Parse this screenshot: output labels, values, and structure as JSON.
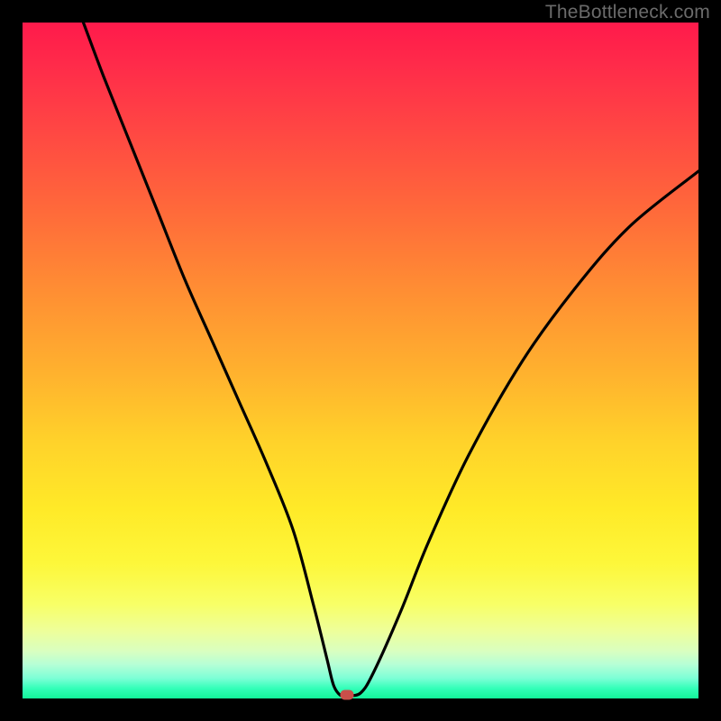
{
  "watermark": "TheBottleneck.com",
  "chart_data": {
    "type": "line",
    "title": "",
    "xlabel": "",
    "ylabel": "",
    "xlim": [
      0,
      100
    ],
    "ylim": [
      0,
      100
    ],
    "grid": false,
    "legend": false,
    "background_gradient": {
      "top": "#ff1a4b",
      "mid": "#ffe128",
      "bottom": "#13f59a"
    },
    "series": [
      {
        "name": "bottleneck-curve",
        "color": "#000000",
        "x": [
          9,
          12,
          16,
          20,
          24,
          28,
          32,
          36,
          40,
          43,
          45,
          46,
          47,
          48,
          50,
          52,
          56,
          60,
          66,
          74,
          82,
          90,
          100
        ],
        "y": [
          100,
          92,
          82,
          72,
          62,
          53,
          44,
          35,
          25,
          14,
          6,
          2,
          0.5,
          0.5,
          0.8,
          4,
          13,
          23,
          36,
          50,
          61,
          70,
          78
        ]
      }
    ],
    "marker": {
      "name": "optimal-point",
      "x": 48,
      "y": 0.5,
      "color": "#c94f4a"
    }
  }
}
